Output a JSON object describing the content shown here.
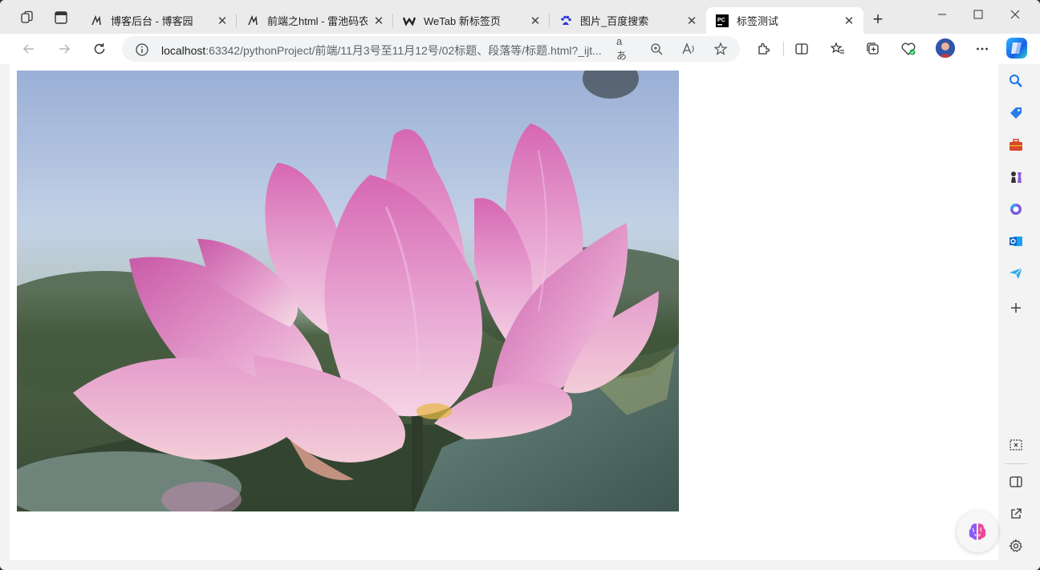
{
  "tabs": [
    {
      "title": "博客后台 - 博客园",
      "favicon": "cnblogs-icon",
      "active": false
    },
    {
      "title": "前端之html - 雷池码农 -",
      "favicon": "cnblogs-icon",
      "active": false
    },
    {
      "title": "WeTab 新标签页",
      "favicon": "wetab-icon",
      "active": false
    },
    {
      "title": "图片_百度搜索",
      "favicon": "baidu-paw-icon",
      "active": false
    },
    {
      "title": "标签测试",
      "favicon": "pycharm-icon",
      "active": true
    }
  ],
  "address_bar": {
    "host": "localhost",
    "rest": ":63342/pythonProject/前端/11月3号至11月12号/02标题、段落等/标题.html?_ijt..."
  },
  "page": {
    "image_alt": "lotus flower"
  },
  "colors": {
    "accent": "#1a5fe8",
    "tab_strip": "#ebebeb",
    "content_bg": "#ffffff"
  },
  "sidebar_icons": [
    "search-icon",
    "shopping-tag-icon",
    "toolbox-icon",
    "chess-icon",
    "microsoft365-icon",
    "outlook-icon",
    "send-icon",
    "add-icon",
    "screenshot-icon",
    "split-panel-icon",
    "open-external-icon",
    "settings-icon"
  ]
}
